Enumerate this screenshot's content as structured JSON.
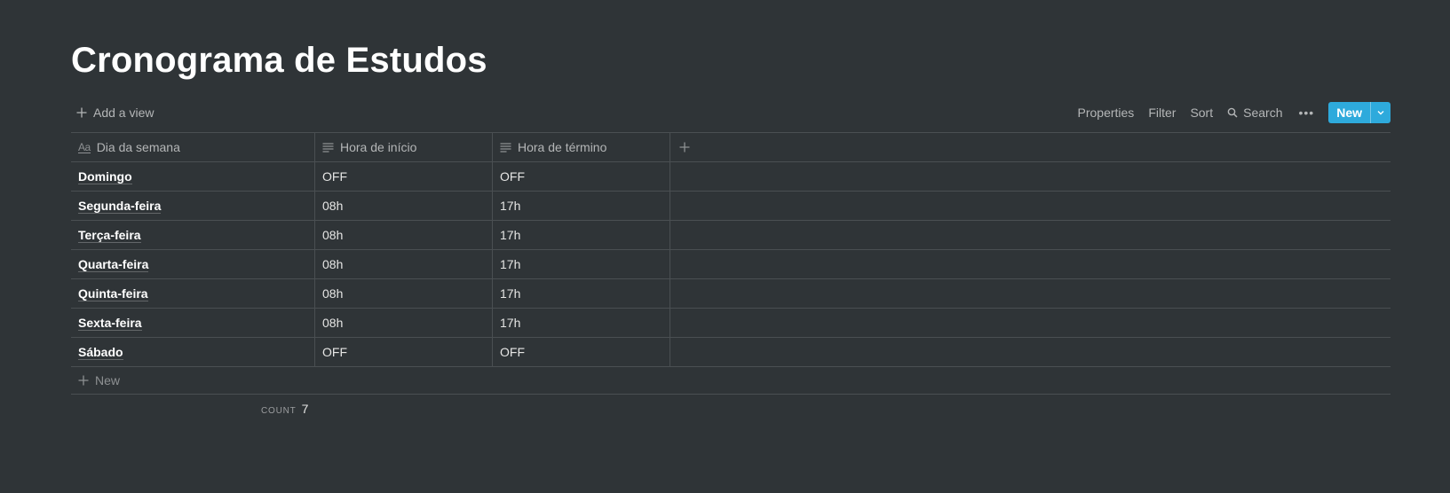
{
  "page": {
    "title": "Cronograma de Estudos"
  },
  "toolbar": {
    "add_view": "Add a view",
    "properties": "Properties",
    "filter": "Filter",
    "sort": "Sort",
    "search": "Search",
    "more": "•••",
    "new": "New"
  },
  "table": {
    "columns": [
      {
        "label": "Dia da semana",
        "icon": "text-title-icon"
      },
      {
        "label": "Hora de início",
        "icon": "text-lines-icon"
      },
      {
        "label": "Hora de término",
        "icon": "text-lines-icon"
      }
    ],
    "rows": [
      {
        "day": "Domingo",
        "start": "OFF",
        "end": "OFF"
      },
      {
        "day": "Segunda-feira",
        "start": "08h",
        "end": "17h"
      },
      {
        "day": "Terça-feira",
        "start": "08h",
        "end": "17h"
      },
      {
        "day": "Quarta-feira",
        "start": "08h",
        "end": "17h"
      },
      {
        "day": "Quinta-feira",
        "start": "08h",
        "end": "17h"
      },
      {
        "day": "Sexta-feira",
        "start": "08h",
        "end": "17h"
      },
      {
        "day": "Sábado",
        "start": "OFF",
        "end": "OFF"
      }
    ],
    "new_row": "New",
    "count_label": "COUNT",
    "count_value": "7",
    "aa_icon_text": "Aa"
  },
  "colors": {
    "background": "#2f3437",
    "accent": "#2eaadc",
    "border": "#4a4f52"
  }
}
